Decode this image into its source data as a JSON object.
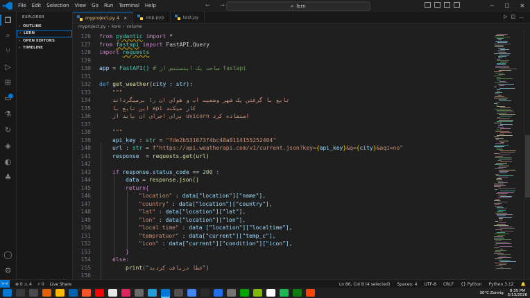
{
  "titlebar": {
    "menu": [
      "File",
      "Edit",
      "Selection",
      "View",
      "Go",
      "Run",
      "Terminal",
      "Help"
    ],
    "search": "lern",
    "nav": "← →"
  },
  "sidebar": {
    "title": "EXPLORER",
    "sections": [
      "OUTLINE",
      "LERN",
      "OPEN EDITORS",
      "TIMELINE"
    ]
  },
  "tabs": [
    {
      "label": "myproject.py",
      "badge": "4",
      "active": true
    },
    {
      "label": "oop.pyp",
      "active": false
    },
    {
      "label": "test.py",
      "active": false
    }
  ],
  "breadcrumbs": [
    "myproject.py",
    "kore",
    "volume"
  ],
  "editor": {
    "lines": [
      {
        "n": "126"
      },
      {
        "n": "127"
      },
      {
        "n": "128"
      },
      {
        "n": "129"
      },
      {
        "n": "130"
      },
      {
        "n": "131"
      },
      {
        "n": "132"
      },
      {
        "n": "133"
      },
      {
        "n": "134"
      },
      {
        "n": "135"
      },
      {
        "n": "136"
      },
      {
        "n": "137"
      },
      {
        "n": "138"
      },
      {
        "n": "139"
      },
      {
        "n": "140"
      },
      {
        "n": "141"
      },
      {
        "n": "142"
      },
      {
        "n": "143"
      },
      {
        "n": "144"
      },
      {
        "n": "145"
      },
      {
        "n": "146"
      },
      {
        "n": "147"
      },
      {
        "n": "148"
      },
      {
        "n": "149"
      },
      {
        "n": "150"
      },
      {
        "n": "151"
      },
      {
        "n": "152"
      },
      {
        "n": "153"
      },
      {
        "n": "154"
      },
      {
        "n": "155"
      },
      {
        "n": "156"
      }
    ],
    "code": {
      "l126": [
        "from",
        "pydantic",
        "import",
        "*"
      ],
      "l127": [
        "from",
        "fastapi",
        "import",
        "FastAPI,Query"
      ],
      "l128": [
        "import",
        "requests"
      ],
      "l130": [
        "app",
        "=",
        "FastAPI()",
        "# ساخت یک اینستنس از fastapi"
      ],
      "l132": [
        "def",
        "get_weather",
        "(city : str):"
      ],
      "l133": "\"\"\"",
      "l134": "تابع با گرفتن یک شهر وضعیت اب و هوای ان را برمیگرداند",
      "l135": "این تابع با api کار میکند",
      "l136": "برای اجرای ان باید از uvicorn استفاده کرد",
      "l138": "\"\"\"",
      "l139_var": "api_key",
      "l139_type": "str",
      "l139_val": "\"fde2b531673f4bc48a8114155252404\"",
      "l140_var": "url",
      "l140_type": "str",
      "l140_pre": "f\"https://api.weatherapi.com/v1/current.json?key=",
      "l140_k": "api_key",
      "l140_mid": "&q=",
      "l140_c": "city",
      "l140_post": "&aqi=no\"",
      "l141_var": "response",
      "l141_call": "requests.get(url)",
      "l143": [
        "if",
        "response.status_code",
        "==",
        "200",
        ":"
      ],
      "l144": [
        "data",
        "=",
        "response.json()"
      ],
      "l145": [
        "return{"
      ],
      "l146": [
        "\"location\"",
        "data[\"location\"][\"name\"],"
      ],
      "l147": [
        "\"country\"",
        "data[\"location\"][\"country\"],"
      ],
      "l148": [
        "\"lat\"",
        "data[\"location\"][\"lat\"],"
      ],
      "l149": [
        "\"lon\"",
        "data[\"location\"][\"lon\"],"
      ],
      "l150": [
        "\"local time\"",
        "data [\"location\"][\"localtime\"],"
      ],
      "l151": [
        "\"tempratuor\"",
        "data[\"current\"][\"temp_c\"],"
      ],
      "l152": [
        "\"icon\"",
        "data[\"current\"][\"condition\"][\"icon\"],"
      ],
      "l153": "}",
      "l154": "else:",
      "l155": [
        "print",
        "(\"خطا دریافت کردید\")"
      ]
    }
  },
  "statusbar": {
    "remote": "><",
    "problems": "⊗ 0 ⚠ 4",
    "ports": "⚡ 0",
    "liveshare": "Live Share",
    "right": [
      "Ln 86, Col 8 (4 selected)",
      "Spaces: 4",
      "UTF-8",
      "CRLF",
      "{} Python",
      "Python 3.12",
      "🔔"
    ]
  },
  "taskbar": {
    "weather": "30°C Zonnig",
    "time": "8:35 PM",
    "date": "5/13/2026"
  },
  "colors": {
    "accent": "#0078d4",
    "bg": "#1f1f1f",
    "keyword": "#c586c0",
    "string": "#ce9178",
    "function": "#dcdcaa"
  }
}
